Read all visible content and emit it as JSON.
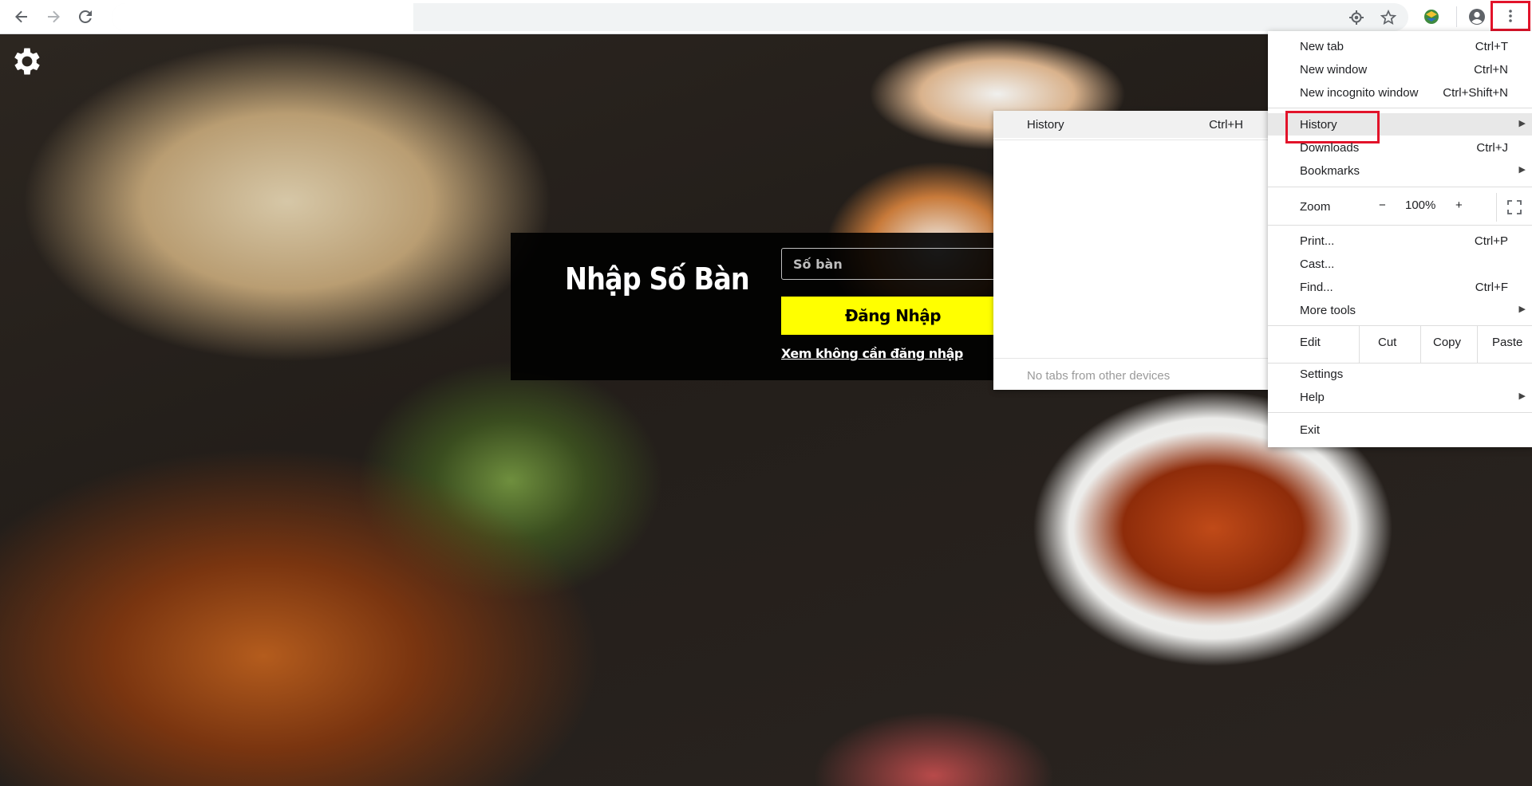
{
  "browser": {
    "nav": {
      "back_icon": "arrow-left-icon",
      "forward_icon": "arrow-right-icon",
      "reload_icon": "reload-icon"
    },
    "omnibox": {
      "value": ""
    },
    "icons": [
      "location-icon",
      "star-icon",
      "extension-icon",
      "profile-icon",
      "more-vert-icon"
    ]
  },
  "page": {
    "settings_icon": "gear-icon",
    "login": {
      "title": "Nhập Số Bàn",
      "input_placeholder": "Số bàn",
      "submit_label": "Đăng Nhập",
      "skip_link": "Xem không cần đăng nhập"
    }
  },
  "history_submenu": {
    "item": {
      "label": "History",
      "shortcut": "Ctrl+H"
    },
    "empty_text": "No tabs from other devices"
  },
  "chrome_menu": {
    "group1": [
      {
        "label": "New tab",
        "shortcut": "Ctrl+T"
      },
      {
        "label": "New window",
        "shortcut": "Ctrl+N"
      },
      {
        "label": "New incognito window",
        "shortcut": "Ctrl+Shift+N"
      }
    ],
    "group2": [
      {
        "label": "History",
        "shortcut": ""
      },
      {
        "label": "Downloads",
        "shortcut": "Ctrl+J"
      },
      {
        "label": "Bookmarks",
        "shortcut": ""
      }
    ],
    "zoom": {
      "label": "Zoom",
      "minus": "−",
      "value": "100%",
      "plus": "+"
    },
    "group3": [
      {
        "label": "Print...",
        "shortcut": "Ctrl+P"
      },
      {
        "label": "Cast...",
        "shortcut": ""
      },
      {
        "label": "Find...",
        "shortcut": "Ctrl+F"
      },
      {
        "label": "More tools",
        "shortcut": ""
      }
    ],
    "edit": {
      "label": "Edit",
      "cut": "Cut",
      "copy": "Copy",
      "paste": "Paste"
    },
    "group4": [
      {
        "label": "Settings",
        "shortcut": ""
      },
      {
        "label": "Help",
        "shortcut": ""
      }
    ],
    "exit": {
      "label": "Exit"
    }
  }
}
